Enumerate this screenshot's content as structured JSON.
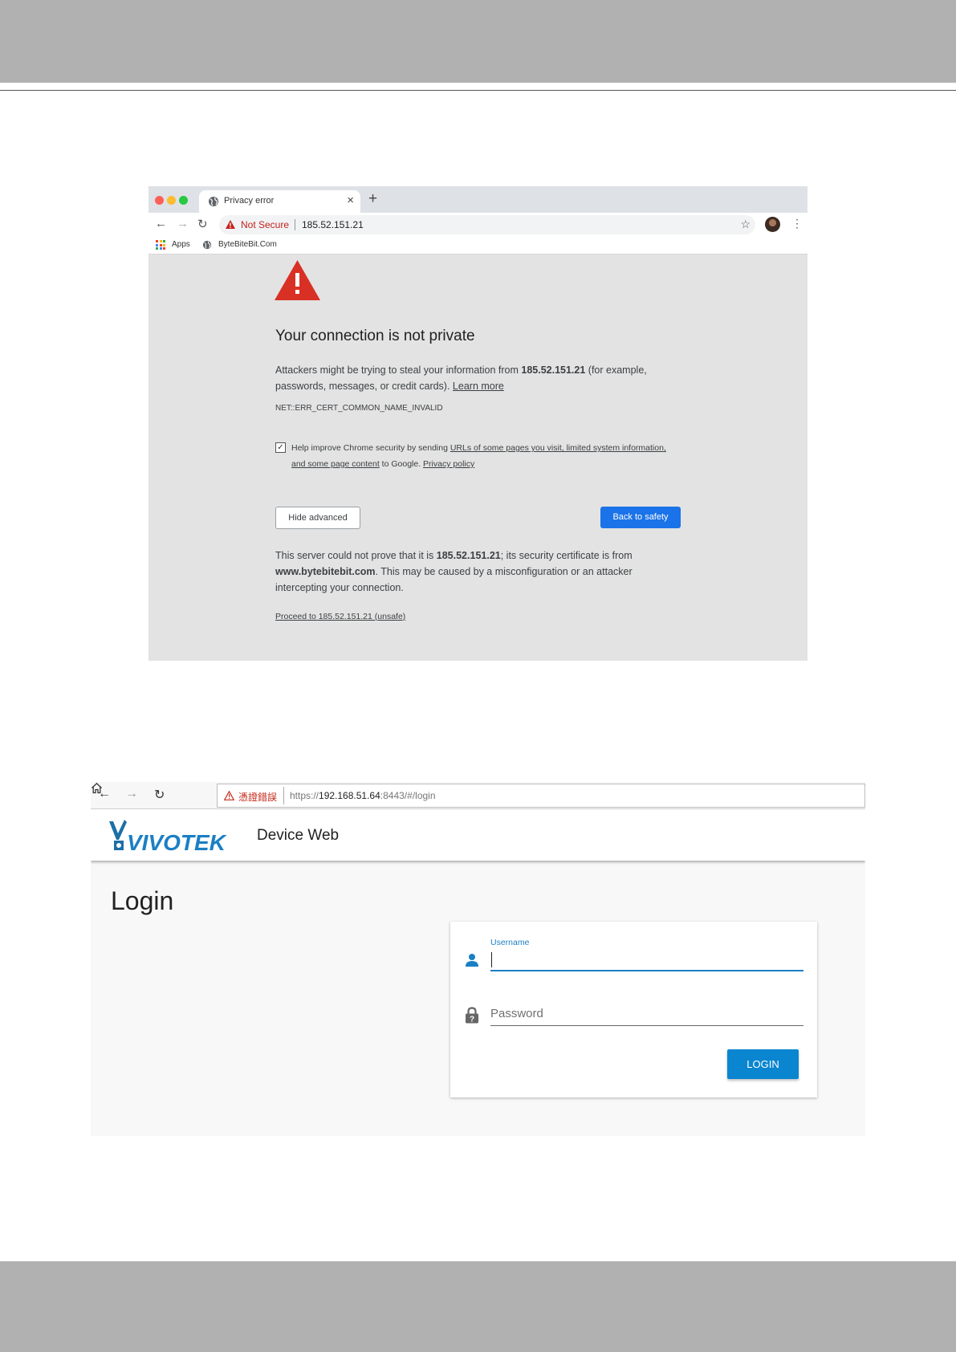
{
  "privacy_error": {
    "tab": {
      "title": "Privacy error",
      "close_glyph": "×",
      "new_tab_glyph": "+",
      "icon": "globe-icon"
    },
    "toolbar": {
      "back_glyph": "←",
      "forward_glyph": "→",
      "reload_glyph": "↻",
      "security_label": "Not Secure",
      "url": "185.52.151.21",
      "star_glyph": "☆",
      "menu_glyph": "⋮"
    },
    "bookmarks": {
      "apps_label": "Apps",
      "site_label": "ByteBiteBit.Com"
    },
    "page": {
      "heading": "Your connection is not private",
      "para_a": "Attackers might be trying to steal your information from ",
      "para_host": "185.52.151.21",
      "para_b": " (for example, passwords, messages, or credit cards). ",
      "learn_more": "Learn more",
      "error_code": "NET::ERR_CERT_COMMON_NAME_INVALID",
      "checkbox_checked": true,
      "checkbox_glyph": "✓",
      "help_a": "Help improve Chrome security by sending ",
      "help_link": "URLs of some pages you visit, limited system information, and some page content",
      "help_b": " to Google. ",
      "privacy_policy": "Privacy policy",
      "hide_advanced": "Hide advanced",
      "back_to_safety": "Back to safety",
      "adv_a": "This server could not prove that it is ",
      "adv_host": "185.52.151.21",
      "adv_b": "; its security certificate is from ",
      "adv_cert_host": "www.bytebitebit.com",
      "adv_c": ". This may be caused by a misconfiguration or an attacker intercepting your connection.",
      "proceed_link": "Proceed to 185.52.151.21 (unsafe)"
    },
    "colors": {
      "warning_red": "#d93025",
      "not_secure_red": "#c5221f",
      "primary_blue": "#1a73e8"
    }
  },
  "vivotek_login": {
    "browser": {
      "back_glyph": "←",
      "forward_glyph": "→",
      "refresh_glyph": "↻",
      "cert_error_label": "憑證錯誤",
      "url_prefix": "https://",
      "url_host": "192.168.51.64",
      "url_suffix": ":8443/#/login"
    },
    "header": {
      "brand": "VIVOTEK",
      "app_title": "Device Web"
    },
    "login": {
      "title": "Login",
      "username_label": "Username",
      "username_value": "",
      "password_placeholder": "Password",
      "login_button": "LOGIN"
    },
    "colors": {
      "brand_blue": "#1b7fc4",
      "button_blue": "#0a85d0",
      "cert_error_red": "#c42b1c"
    }
  }
}
